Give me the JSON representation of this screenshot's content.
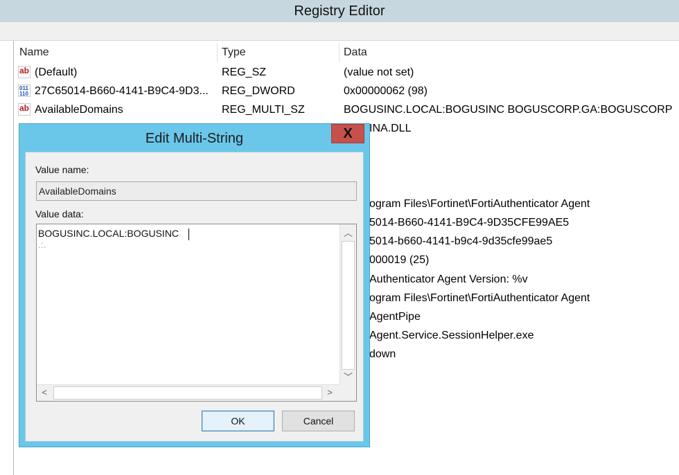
{
  "window": {
    "title": "Registry Editor"
  },
  "list": {
    "columns": [
      "Name",
      "Type",
      "Data"
    ],
    "rows": [
      {
        "icon": "string-value-icon",
        "name": "(Default)",
        "type": "REG_SZ",
        "data": "(value not set)"
      },
      {
        "icon": "binary-value-icon",
        "name": "27C65014-B660-4141-B9C4-9D3...",
        "type": "REG_DWORD",
        "data": "0x00000062 (98)"
      },
      {
        "icon": "string-value-icon",
        "name": "AvailableDomains",
        "type": "REG_MULTI_SZ",
        "data": "BOGUSINC.LOCAL:BOGUSINC BOGUSCORP.GA:BOGUSCORP .:."
      }
    ],
    "partial_data": [
      "INA.DLL",
      "ogram Files\\Fortinet\\FortiAuthenticator Agent",
      "5014-B660-4141-B9C4-9D35CFE99AE5",
      "5014-b660-4141-b9c4-9d35cfe99ae5",
      "000019 (25)",
      "Authenticator Agent Version: %v",
      "ogram Files\\Fortinet\\FortiAuthenticator Agent",
      "AgentPipe",
      "Agent.Service.SessionHelper.exe",
      "down"
    ]
  },
  "dialog": {
    "title": "Edit Multi-String",
    "close_glyph": "X",
    "value_name_label": "Value name:",
    "value_name": "AvailableDomains",
    "value_data_label": "Value data:",
    "value_data_lines": [
      "BOGUSINC.LOCAL:BOGUSINC",
      ".:."
    ],
    "ok_label": "OK",
    "cancel_label": "Cancel"
  }
}
